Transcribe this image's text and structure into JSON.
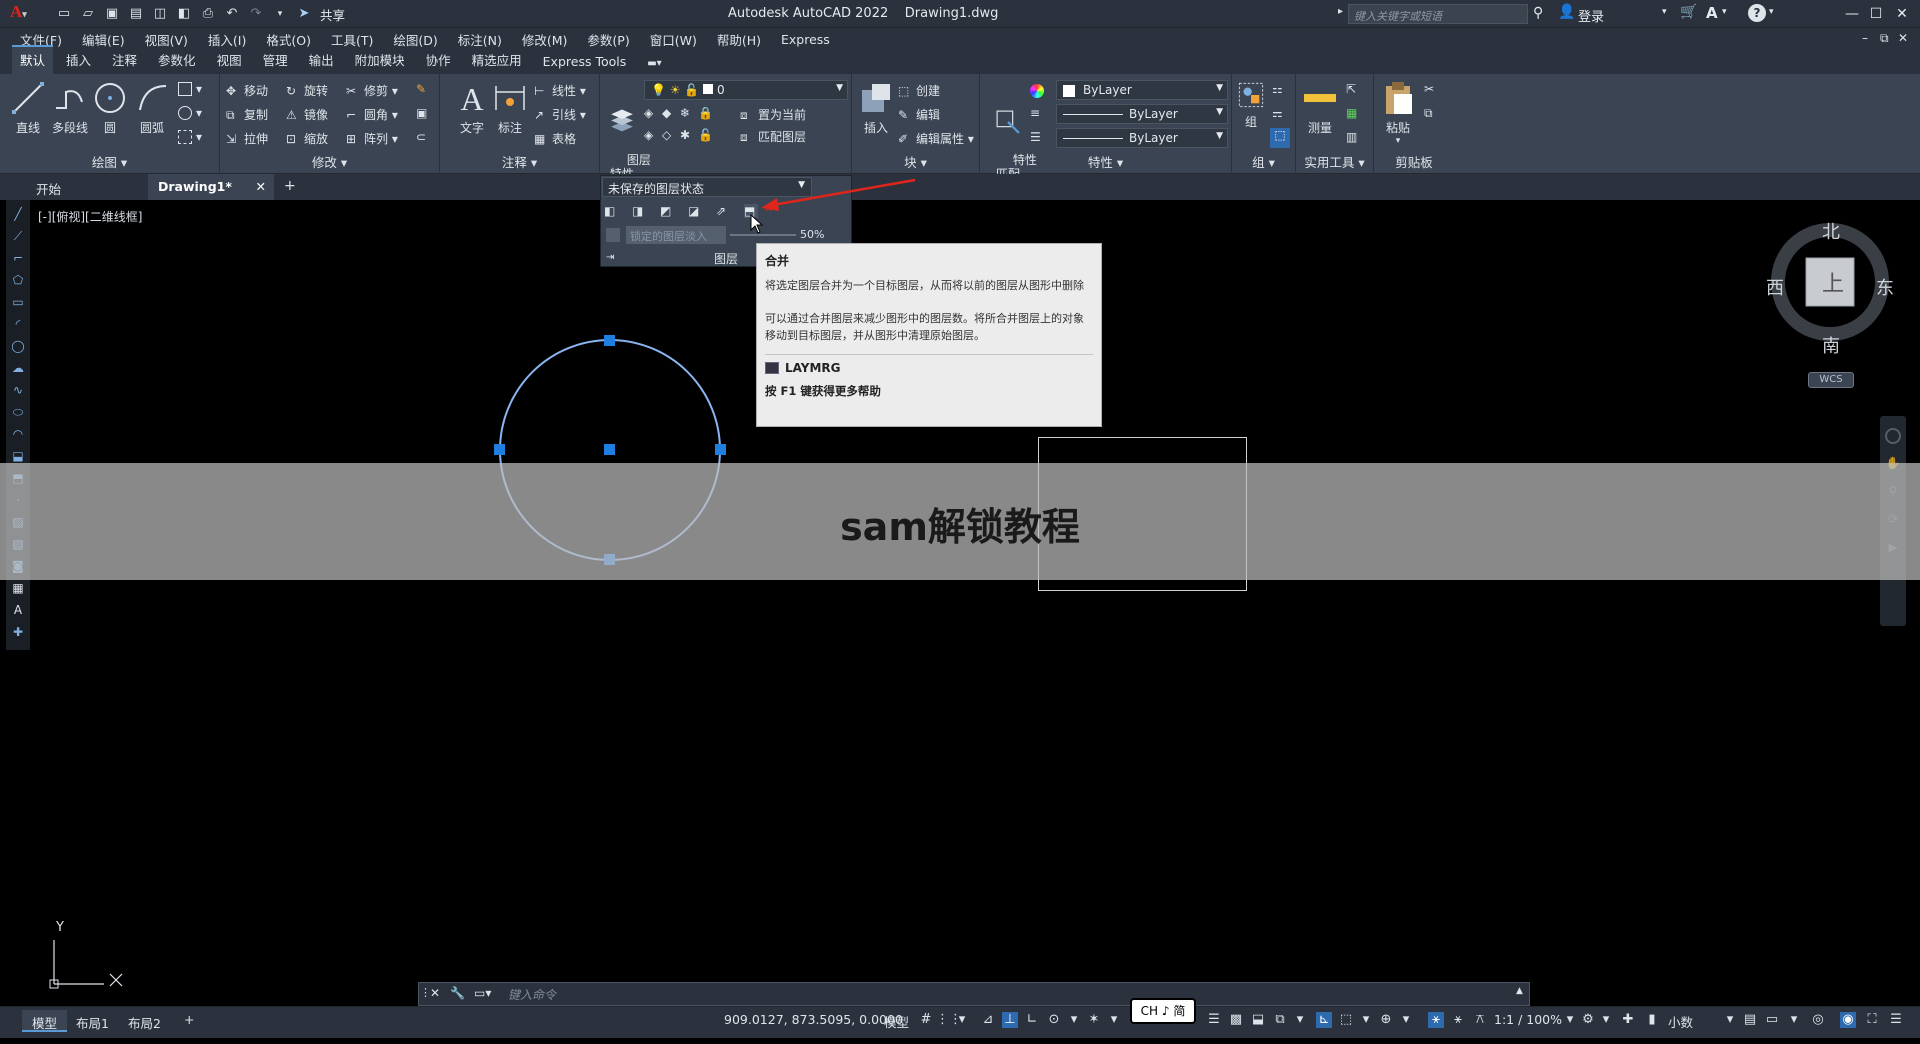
{
  "titlebar": {
    "app_title": "Autodesk AutoCAD 2022    Drawing1.dwg",
    "share": "共享",
    "search_placeholder": "键入关键字或短语",
    "login": "登录"
  },
  "menubar": [
    "文件(F)",
    "编辑(E)",
    "视图(V)",
    "插入(I)",
    "格式(O)",
    "工具(T)",
    "绘图(D)",
    "标注(N)",
    "修改(M)",
    "参数(P)",
    "窗口(W)",
    "帮助(H)",
    "Express"
  ],
  "ribbon_tabs": [
    "默认",
    "插入",
    "注释",
    "参数化",
    "视图",
    "管理",
    "输出",
    "附加模块",
    "协作",
    "精选应用",
    "Express Tools"
  ],
  "ribbon": {
    "draw": {
      "title": "绘图",
      "line": "直线",
      "polyline": "多段线",
      "circle": "圆",
      "arc": "圆弧"
    },
    "modify": {
      "title": "修改",
      "move": "移动",
      "rotate": "旋转",
      "trim": "修剪",
      "copy": "复制",
      "mirror": "镜像",
      "fillet": "圆角",
      "stretch": "拉伸",
      "scale": "缩放",
      "array": "阵列"
    },
    "annotation": {
      "title": "注释",
      "text": "文字",
      "dimension": "标注",
      "linear": "线性",
      "leader": "引线",
      "table": "表格"
    },
    "layers": {
      "title": "图层",
      "props": "图层\n特性",
      "current_layer": "0",
      "make_current": "置为当前",
      "match_layer": "匹配图层"
    },
    "block": {
      "title": "块",
      "insert": "插入",
      "create": "创建",
      "edit": "编辑",
      "edit_attr": "编辑属性"
    },
    "properties": {
      "title": "特性",
      "match": "特性\n匹配",
      "color": "ByLayer",
      "linetype": "ByLayer",
      "lineweight": "ByLayer"
    },
    "groups": {
      "title": "组",
      "group": "组"
    },
    "utilities": {
      "title": "实用工具",
      "measure": "测量"
    },
    "clipboard": {
      "title": "剪贴板",
      "paste": "粘贴"
    }
  },
  "file_tabs": {
    "start": "开始",
    "drawing": "Drawing1*"
  },
  "viewport_label": "[-][俯视][二维线框]",
  "layer_panel": {
    "state": "未保存的图层状态",
    "lock_fade": "锁定的图层淡入",
    "fade_pct": "50%",
    "title": "图层"
  },
  "tooltip": {
    "title": "合并",
    "desc1": "将选定图层合并为一个目标图层，从而将以前的图层从图形中删除",
    "desc2": "可以通过合并图层来减少图形中的图层数。将所合并图层上的对象移动到目标图层，并从图形中清理原始图层。",
    "command": "LAYMRG",
    "help": "按 F1 键获得更多帮助"
  },
  "watermark": "sam解锁教程",
  "viewcube": {
    "north": "北",
    "south": "南",
    "east": "东",
    "west": "西",
    "top": "上",
    "wcs": "WCS"
  },
  "ucs": {
    "y": "Y"
  },
  "command_line": {
    "placeholder": "键入命令"
  },
  "statusbar": {
    "layout_tabs": [
      "模型",
      "布局1",
      "布局2"
    ],
    "coords": "909.0127, 873.5095, 0.0000",
    "model": "模型",
    "ime": "CH ♪ 简",
    "scale": "1:1 / 100%",
    "units": "小数"
  },
  "colors": {
    "accent": "#5a9bd5",
    "ribbon_bg": "#3a4452",
    "titlebar_bg": "#2b323d",
    "grip": "#1e7fe0",
    "arrow": "#e0251b"
  }
}
